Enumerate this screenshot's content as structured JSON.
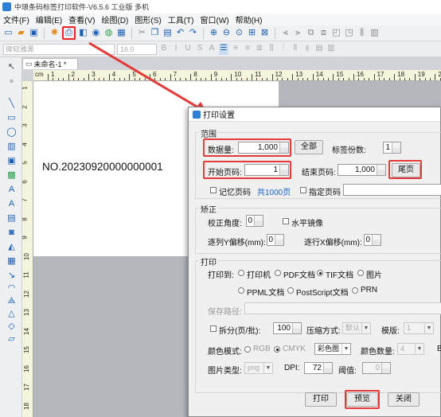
{
  "window": {
    "title": "中琅条码标签打印软件-V6.5.6 工业版 多机"
  },
  "menu": [
    "文件(F)",
    "编辑(E)",
    "查看(V)",
    "绘图(D)",
    "图形(S)",
    "工具(T)",
    "窗口(W)",
    "帮助(H)"
  ],
  "format_bar": {
    "font_name": "微软雅黑",
    "font_size": "16.0"
  },
  "document": {
    "tab_label": "未命名-1 *",
    "barcode_text": "NO.20230920000000001"
  },
  "ruler": {
    "unit": "cm",
    "h_numbers": [
      "1",
      "2",
      "3",
      "4",
      "5",
      "6",
      "7",
      "8",
      "9",
      "10",
      "11",
      "12",
      "13",
      "14",
      "15",
      "16",
      "17",
      "18",
      "19",
      "20"
    ],
    "v_numbers": [
      "1",
      "2",
      "3",
      "4",
      "5",
      "6",
      "7",
      "8",
      "9",
      "10",
      "11",
      "12",
      "13",
      "14",
      "15",
      "16",
      "17",
      "18"
    ]
  },
  "dialog": {
    "title": "打印设置",
    "range": {
      "section": "范围",
      "quantity_label": "数据量:",
      "quantity_value": "1,000",
      "all_button": "全部",
      "copies_label": "标签份数:",
      "copies_value": "1",
      "start_label": "开始页码:",
      "start_value": "1",
      "end_label": "结束页码:",
      "end_value": "1,000",
      "last_page_button": "尾页",
      "remember_label": "记忆页码",
      "total_pages": "共1000页",
      "specify_label": "指定页码"
    },
    "correction": {
      "section": "矫正",
      "angle_label": "校正角度:",
      "angle_value": "0",
      "mirror_label": "水平镜像",
      "y_offset_label": "逐列Y偏移(mm):",
      "y_offset_value": "0",
      "x_offset_label": "逐行X偏移(mm):",
      "x_offset_value": "0"
    },
    "print": {
      "section": "打印",
      "print_to_label": "打印到:",
      "targets": [
        "打印机",
        "PDF文档",
        "TIF文档",
        "图片",
        "PPML文档",
        "PostScript文档",
        "PRN"
      ],
      "selected_target": "TIF文档",
      "save_path_label": "保存路径:",
      "split_label": "拆分(页/批):",
      "split_value": "100",
      "compress_label": "压缩方式:",
      "compress_value": "默认",
      "template_label": "模版:",
      "template_value": "1",
      "color_mode_label": "颜色模式:",
      "rgb_label": "RGB",
      "cmyk_label": "CMYK",
      "color_value": "彩色图",
      "color_count_label": "颜色数量:",
      "color_count_value": "4",
      "b_label": "B",
      "image_type_label": "图片类型:",
      "image_type_value": "png",
      "dpi_label": "DPI:",
      "dpi_value": "72",
      "threshold_label": "阈值:",
      "threshold_value": "0"
    },
    "buttons": {
      "print": "打印",
      "preview": "预览",
      "close": "关闭"
    }
  },
  "colors": {
    "highlight_red": "#e53a3a",
    "accent_blue": "#1560c7"
  }
}
